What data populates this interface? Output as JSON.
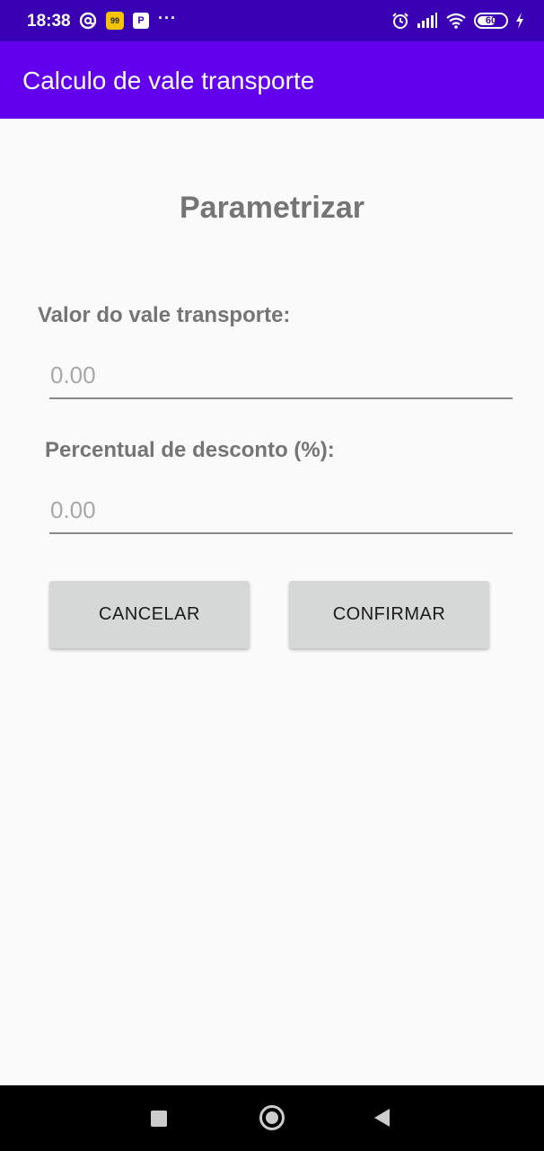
{
  "status_bar": {
    "time": "18:38",
    "food_badge": "99",
    "p_badge": "P",
    "more": "···",
    "battery_level": "60",
    "icons": [
      "at-icon",
      "food-app-icon",
      "parking-icon",
      "more-icon",
      "alarm-icon",
      "signal-icon",
      "wifi-icon",
      "battery-icon",
      "charging-icon"
    ]
  },
  "app_bar": {
    "title": "Calculo de vale transporte"
  },
  "main": {
    "heading": "Parametrizar",
    "vale_label": "Valor do vale transporte:",
    "vale_placeholder": "0.00",
    "desconto_label": "Percentual de desconto (%):",
    "desconto_placeholder": "0.00",
    "cancel_label": "CANCELAR",
    "confirm_label": "CONFIRMAR"
  },
  "nav_bar": {
    "icons": [
      "recents-icon",
      "home-icon",
      "back-icon"
    ]
  },
  "colors": {
    "status_bar": "#3a00b4",
    "app_bar": "#6200ee",
    "button": "#d6d7d7",
    "background": "#fafafa"
  }
}
